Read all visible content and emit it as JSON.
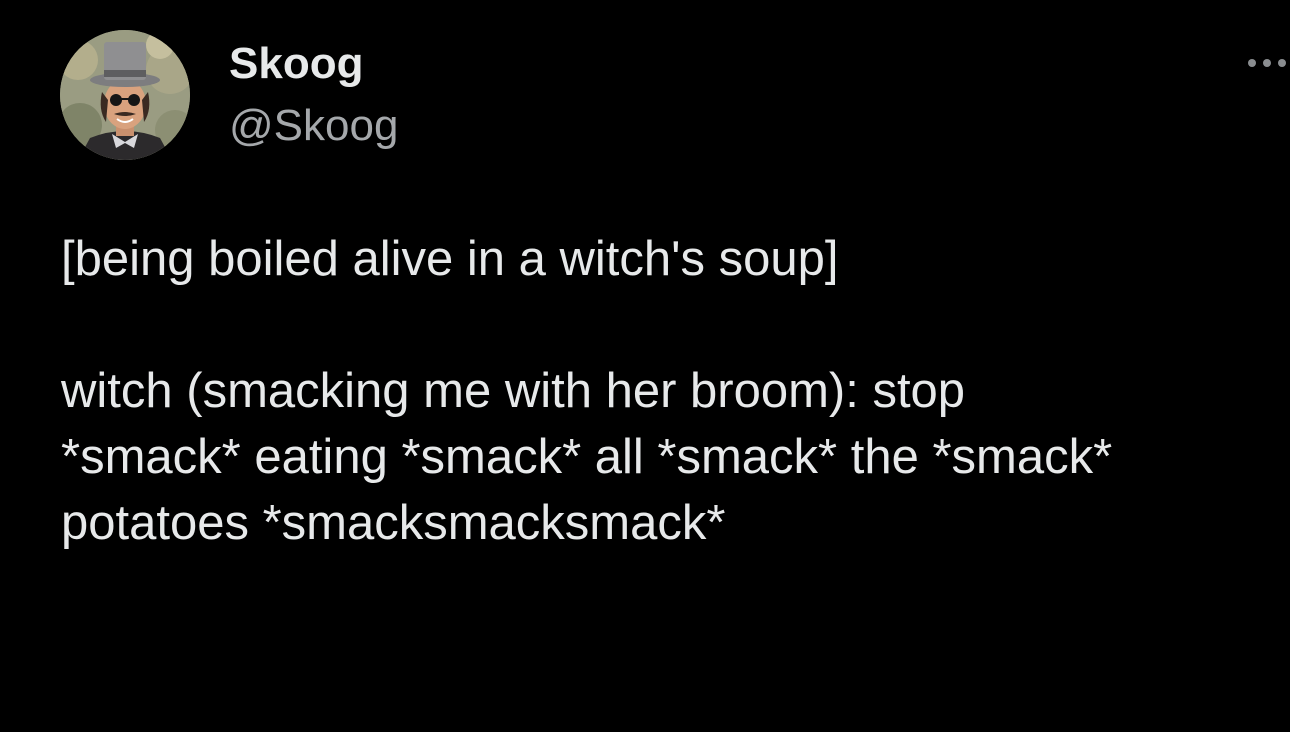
{
  "author": {
    "display_name": "Skoog",
    "handle": "@Skoog",
    "avatar_icon": "avatar-photo-man-top-hat"
  },
  "more_icon": "more-dots-icon",
  "tweet": {
    "lines": [
      "[being boiled alive in a witch's soup]",
      "witch (smacking me with her broom): stop",
      "*smack* eating *smack* all *smack* the *smack*",
      "potatoes *smacksmacksmack*"
    ]
  },
  "colors": {
    "background": "#000000",
    "text_primary": "#e7e9ea",
    "text_secondary": "#a5a8ab"
  }
}
